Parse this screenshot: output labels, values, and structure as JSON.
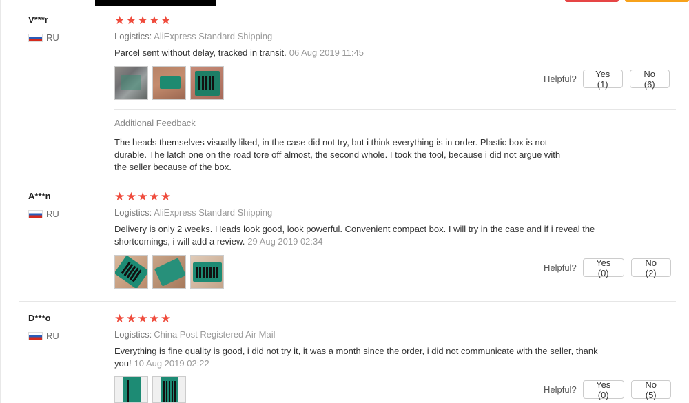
{
  "reviews": [
    {
      "user": "V***r",
      "country": "RU",
      "rating": 5,
      "logistics_label": "Logistics:",
      "logistics_value": "AliExpress Standard Shipping",
      "text": "Parcel sent without delay, tracked in transit.",
      "date": "06 Aug 2019 11:45",
      "helpful_label": "Helpful?",
      "yes_label": "Yes (1)",
      "no_label": "No (6)",
      "additional_title": "Additional Feedback",
      "additional_text": "The heads themselves visually liked, in the case did not try, but i think everything is in order. Plastic box is not durable. The latch one on the road tore off almost, the second whole. I took the tool, because i did not argue with the seller because of the box."
    },
    {
      "user": "A***n",
      "country": "RU",
      "rating": 5,
      "logistics_label": "Logistics:",
      "logistics_value": "AliExpress Standard Shipping",
      "text": "Delivery is only 2 weeks. Heads look good, look powerful. Convenient compact box. I will try in the case and if i reveal the shortcomings, i will add a review.",
      "date": "29 Aug 2019 02:34",
      "helpful_label": "Helpful?",
      "yes_label": "Yes (0)",
      "no_label": "No (2)"
    },
    {
      "user": "D***o",
      "country": "RU",
      "rating": 5,
      "logistics_label": "Logistics:",
      "logistics_value": "China Post Registered Air Mail",
      "text": "Everything is fine quality is good, i did not try it, it was a month since the order, i did not communicate with the seller, thank you!",
      "date": "10 Aug 2019 02:22",
      "helpful_label": "Helpful?",
      "yes_label": "Yes (0)",
      "no_label": "No (5)"
    }
  ],
  "star_glyph": "★",
  "colors": {
    "star": "#ef4b3c",
    "muted": "#999999"
  }
}
